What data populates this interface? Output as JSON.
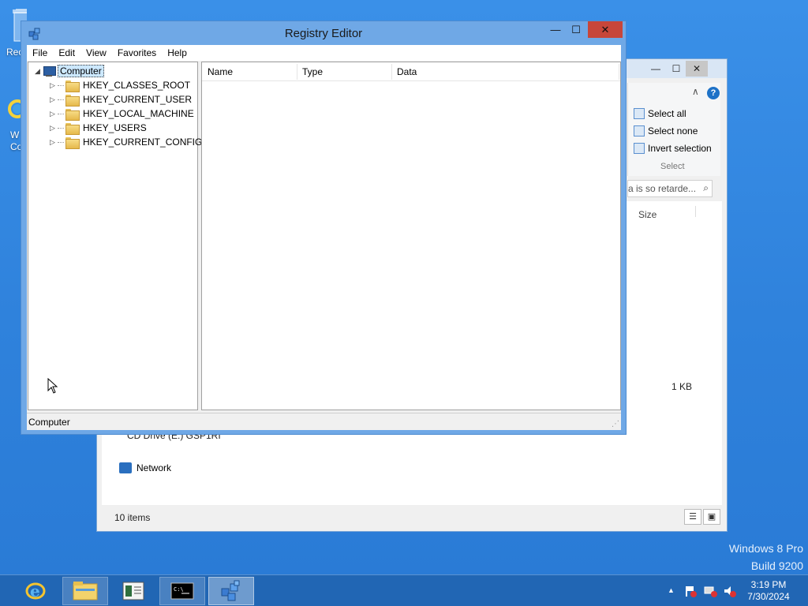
{
  "desktop": {
    "icons": [
      {
        "label": "Rec"
      },
      {
        "label_line1": "W",
        "label_line2": "Com"
      }
    ],
    "watermark": {
      "line1": "Windows 8 Pro",
      "line2": "Build 9200"
    }
  },
  "explorer": {
    "ribbon": {
      "select_all": "Select all",
      "select_none": "Select none",
      "invert_selection": "Invert selection",
      "group_label": "Select"
    },
    "search_text": "a is so retarde...",
    "columns": {
      "size": "Size"
    },
    "file_size": "1 KB",
    "cd_drive": "CD Drive (E:) GSP1RI",
    "network": "Network",
    "status": "10 items"
  },
  "regedit": {
    "title": "Registry Editor",
    "menu": [
      "File",
      "Edit",
      "View",
      "Favorites",
      "Help"
    ],
    "tree": {
      "root": "Computer",
      "children": [
        "HKEY_CLASSES_ROOT",
        "HKEY_CURRENT_USER",
        "HKEY_LOCAL_MACHINE",
        "HKEY_USERS",
        "HKEY_CURRENT_CONFIG"
      ]
    },
    "columns": {
      "name": "Name",
      "type": "Type",
      "data": "Data"
    },
    "status": "Computer"
  },
  "taskbar": {
    "clock_time": "3:19 PM",
    "clock_date": "7/30/2024"
  },
  "colors": {
    "desktop": "#2f82dc",
    "taskbar": "#2166b4",
    "window_frame": "#6fa8e6",
    "close_button": "#c7463a"
  }
}
